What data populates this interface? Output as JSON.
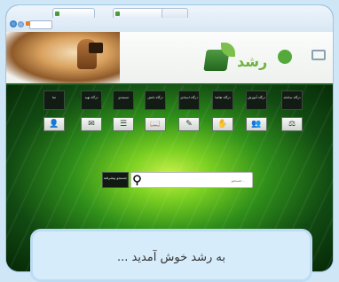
{
  "browser": {
    "tabs": [
      "",
      "",
      ""
    ]
  },
  "header": {
    "logo_text": "رشد"
  },
  "menu": {
    "items": [
      {
        "label": "درگاه سامانه",
        "icon": "rules-icon"
      },
      {
        "label": "درگاه آموزش",
        "icon": "people-icon"
      },
      {
        "label": "درگاه تقاضا",
        "icon": "hand-icon"
      },
      {
        "label": "درگاه استادی",
        "icon": "writing-icon"
      },
      {
        "label": "درگاه دانش",
        "icon": "book-icon"
      },
      {
        "label": "مستندی",
        "icon": "list-icon"
      },
      {
        "label": "درگاه تهیه",
        "icon": "chat-icon"
      },
      {
        "label": "منا",
        "icon": "person-icon"
      }
    ]
  },
  "search": {
    "placeholder": "جستجو...",
    "button_label": "جستجو پیشرفته"
  },
  "caption": {
    "text": "... به رشد خوش آمدید"
  }
}
